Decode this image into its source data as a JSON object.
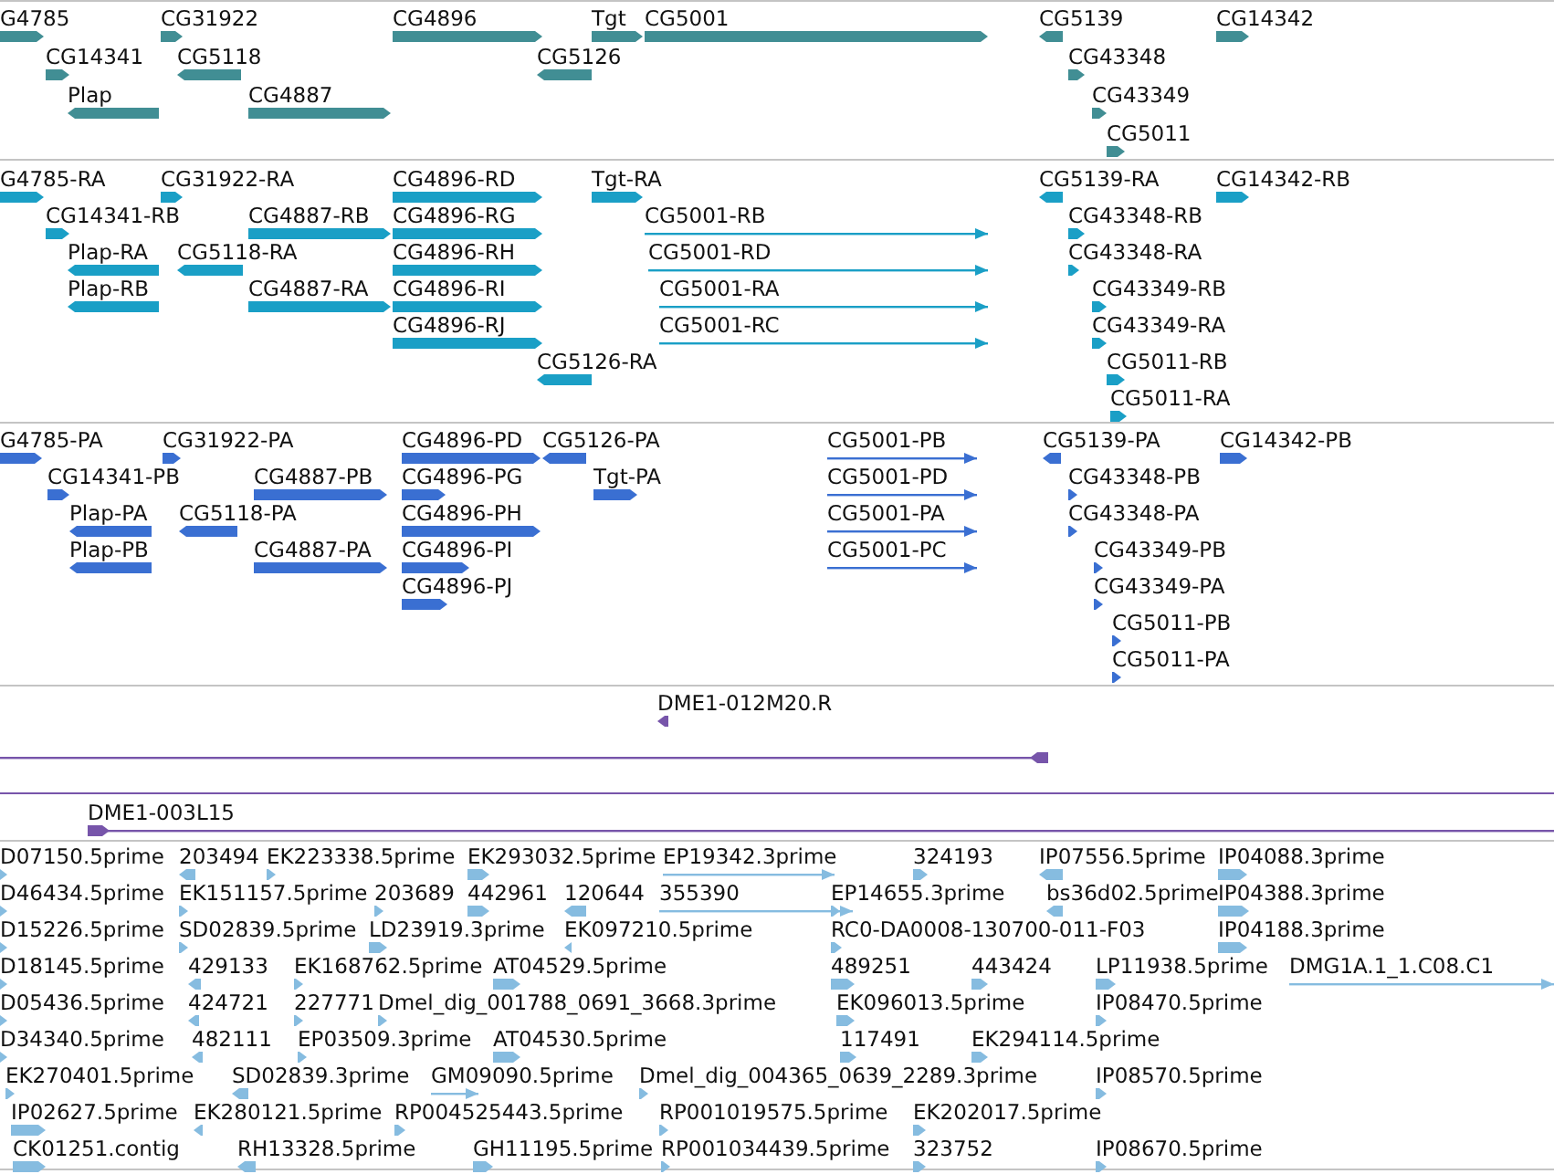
{
  "tracks": [
    {
      "features": [
        {
          "label": "G4785",
          "reverse": false
        },
        {
          "label": "CG31922",
          "reverse": false
        },
        {
          "label": "CG4896",
          "reverse": false
        },
        {
          "label": "Tgt",
          "reverse": false
        },
        {
          "label": "CG5001",
          "reverse": false
        },
        {
          "label": "CG5139",
          "reverse": true
        },
        {
          "label": "CG14342",
          "reverse": false
        },
        {
          "label": "CG14341",
          "reverse": false
        },
        {
          "label": "CG5118",
          "reverse": true
        },
        {
          "label": "CG5126",
          "reverse": true
        },
        {
          "label": "CG43348",
          "reverse": false
        },
        {
          "label": "Plap",
          "reverse": true
        },
        {
          "label": "CG4887",
          "reverse": false
        },
        {
          "label": "CG43349",
          "reverse": false
        },
        {
          "label": "CG5011",
          "reverse": false
        }
      ]
    },
    {
      "features": [
        {
          "label": "G4785-RA",
          "reverse": false
        },
        {
          "label": "CG31922-RA",
          "reverse": false
        },
        {
          "label": "CG4896-RD",
          "reverse": false
        },
        {
          "label": "Tgt-RA",
          "reverse": false
        },
        {
          "label": "CG5139-RA",
          "reverse": true
        },
        {
          "label": "CG14342-RB",
          "reverse": false
        },
        {
          "label": "CG14341-RB",
          "reverse": false
        },
        {
          "label": "CG4887-RB",
          "reverse": false
        },
        {
          "label": "CG4896-RG",
          "reverse": false
        },
        {
          "label": "CG5001-RB",
          "reverse": false
        },
        {
          "label": "CG43348-RB",
          "reverse": false
        },
        {
          "label": "Plap-RA",
          "reverse": true
        },
        {
          "label": "CG5118-RA",
          "reverse": true
        },
        {
          "label": "CG4896-RH",
          "reverse": false
        },
        {
          "label": "CG5001-RD",
          "reverse": false
        },
        {
          "label": "CG43348-RA",
          "reverse": false
        },
        {
          "label": "Plap-RB",
          "reverse": true
        },
        {
          "label": "CG4887-RA",
          "reverse": false
        },
        {
          "label": "CG4896-RI",
          "reverse": false
        },
        {
          "label": "CG5001-RA",
          "reverse": false
        },
        {
          "label": "CG43349-RB",
          "reverse": false
        },
        {
          "label": "CG4896-RJ",
          "reverse": false
        },
        {
          "label": "CG5001-RC",
          "reverse": false
        },
        {
          "label": "CG43349-RA",
          "reverse": false
        },
        {
          "label": "CG5126-RA",
          "reverse": true
        },
        {
          "label": "CG5011-RB",
          "reverse": false
        },
        {
          "label": "CG5011-RA",
          "reverse": false
        }
      ]
    },
    {
      "features": [
        {
          "label": "G4785-PA",
          "reverse": false
        },
        {
          "label": "CG31922-PA",
          "reverse": false
        },
        {
          "label": "CG4896-PD",
          "reverse": false
        },
        {
          "label": "CG5126-PA",
          "reverse": true
        },
        {
          "label": "CG5001-PB",
          "reverse": false
        },
        {
          "label": "CG5139-PA",
          "reverse": true
        },
        {
          "label": "CG14342-PB",
          "reverse": false
        },
        {
          "label": "CG14341-PB",
          "reverse": false
        },
        {
          "label": "CG4887-PB",
          "reverse": false
        },
        {
          "label": "CG4896-PG",
          "reverse": false
        },
        {
          "label": "Tgt-PA",
          "reverse": false
        },
        {
          "label": "CG5001-PD",
          "reverse": false
        },
        {
          "label": "CG43348-PB",
          "reverse": false
        },
        {
          "label": "Plap-PA",
          "reverse": true
        },
        {
          "label": "CG5118-PA",
          "reverse": true
        },
        {
          "label": "CG4896-PH",
          "reverse": false
        },
        {
          "label": "CG5001-PA",
          "reverse": false
        },
        {
          "label": "CG43348-PA",
          "reverse": false
        },
        {
          "label": "Plap-PB",
          "reverse": true
        },
        {
          "label": "CG4887-PA",
          "reverse": false
        },
        {
          "label": "CG4896-PI",
          "reverse": false
        },
        {
          "label": "CG5001-PC",
          "reverse": false
        },
        {
          "label": "CG43349-PB",
          "reverse": false
        },
        {
          "label": "CG4896-PJ",
          "reverse": false
        },
        {
          "label": "CG43349-PA",
          "reverse": false
        },
        {
          "label": "CG5011-PB",
          "reverse": false
        },
        {
          "label": "CG5011-PA",
          "reverse": false
        }
      ]
    },
    {
      "features": [
        {
          "label": "DME1-012M20.R",
          "reverse": true
        },
        {
          "reverse": true
        },
        {
          "label": "DME1-003L15",
          "reverse": false
        }
      ]
    },
    {
      "features": [
        {
          "label": "D07150.5prime",
          "reverse": false
        },
        {
          "label": "203494",
          "reverse": true
        },
        {
          "label": "EK223338.5prime",
          "reverse": false
        },
        {
          "label": "EK293032.5prime",
          "reverse": false
        },
        {
          "label": "EP19342.3prime",
          "reverse": false
        },
        {
          "label": "324193",
          "reverse": false
        },
        {
          "label": "IP07556.5prime",
          "reverse": true
        },
        {
          "label": "IP04088.3prime",
          "reverse": false
        },
        {
          "label": "D46434.5prime",
          "reverse": false
        },
        {
          "label": "EK151157.5prime",
          "reverse": false
        },
        {
          "label": "203689",
          "reverse": false
        },
        {
          "label": "442961",
          "reverse": false
        },
        {
          "label": "120644",
          "reverse": true
        },
        {
          "label": "355390",
          "reverse": false
        },
        {
          "label": "EP14655.3prime",
          "reverse": false
        },
        {
          "label": "bs36d02.5prime",
          "reverse": true
        },
        {
          "label": "IP04388.3prime",
          "reverse": false
        },
        {
          "label": "D15226.5prime",
          "reverse": false
        },
        {
          "label": "SD02839.5prime",
          "reverse": false
        },
        {
          "label": "LD23919.3prime",
          "reverse": false
        },
        {
          "label": "EK097210.5prime",
          "reverse": true
        },
        {
          "label": "RC0-DA0008-130700-011-F03",
          "reverse": false
        },
        {
          "label": "IP04188.3prime",
          "reverse": false
        },
        {
          "label": "D18145.5prime",
          "reverse": false
        },
        {
          "label": "429133",
          "reverse": true
        },
        {
          "label": "EK168762.5prime",
          "reverse": false
        },
        {
          "label": "AT04529.5prime",
          "reverse": false
        },
        {
          "label": "489251",
          "reverse": false
        },
        {
          "label": "443424",
          "reverse": false
        },
        {
          "label": "LP11938.5prime",
          "reverse": false
        },
        {
          "label": "DMG1A.1_1.C08.C1",
          "reverse": false
        },
        {
          "label": "D05436.5prime",
          "reverse": false
        },
        {
          "label": "424721",
          "reverse": true
        },
        {
          "label": "227771",
          "reverse": false
        },
        {
          "label": "Dmel_dig_001788_0691_3668.3prime",
          "reverse": false
        },
        {
          "label": "EK096013.5prime",
          "reverse": false
        },
        {
          "label": "IP08470.5prime",
          "reverse": false
        },
        {
          "label": "D34340.5prime",
          "reverse": false
        },
        {
          "label": "482111",
          "reverse": true
        },
        {
          "label": "EP03509.3prime",
          "reverse": false
        },
        {
          "label": "AT04530.5prime",
          "reverse": false
        },
        {
          "label": "117491",
          "reverse": false
        },
        {
          "label": "EK294114.5prime",
          "reverse": false
        },
        {
          "label": "EK270401.5prime",
          "reverse": false
        },
        {
          "label": "SD02839.3prime",
          "reverse": true
        },
        {
          "label": "GM09090.5prime",
          "reverse": false
        },
        {
          "label": "Dmel_dig_004365_0639_2289.3prime",
          "reverse": false
        },
        {
          "label": "IP08570.5prime",
          "reverse": false
        },
        {
          "label": "IP02627.5prime",
          "reverse": false
        },
        {
          "label": "EK280121.5prime",
          "reverse": true
        },
        {
          "label": "RP004525443.5prime",
          "reverse": false
        },
        {
          "label": "RP001019575.5prime",
          "reverse": false
        },
        {
          "label": "EK202017.5prime",
          "reverse": false
        },
        {
          "label": "CK01251.contig",
          "reverse": false
        },
        {
          "label": "RH13328.5prime",
          "reverse": true
        },
        {
          "label": "GH11195.5prime",
          "reverse": false
        },
        {
          "label": "RP001034439.5prime",
          "reverse": false
        },
        {
          "label": "323752",
          "reverse": false
        },
        {
          "label": "IP08670.5prime",
          "reverse": false
        }
      ]
    }
  ]
}
